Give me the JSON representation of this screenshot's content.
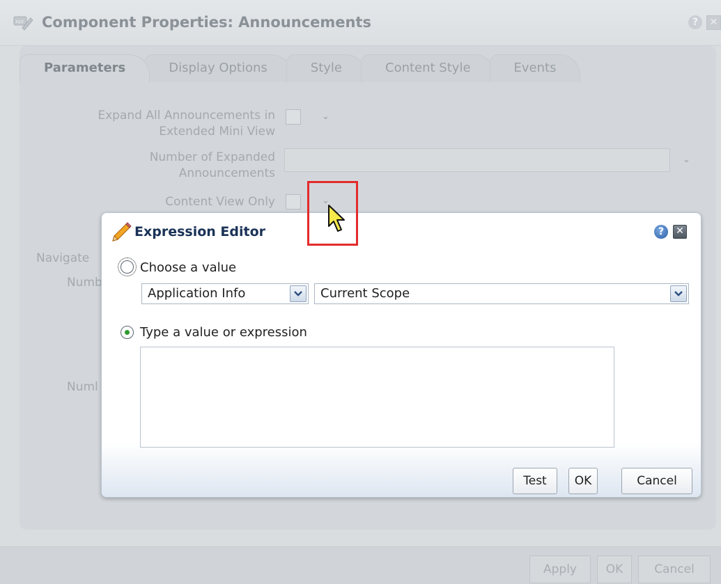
{
  "background_dialog": {
    "title": "Component Properties: Announcements",
    "tabs": [
      "Parameters",
      "Display Options",
      "Style",
      "Content Style",
      "Events"
    ],
    "active_tab": "Parameters",
    "params": {
      "expand_label_line1": "Expand All Announcements in",
      "expand_label_line2": "Extended Mini View",
      "number_label_line1": "Number of Expanded",
      "number_label_line2": "Announcements",
      "content_view_label": "Content View Only",
      "navigate_label_partial": "Navigate",
      "numb_label_partial_1": "Numb",
      "numb_label_partial_2": "Numl"
    },
    "footer": {
      "apply": "Apply",
      "ok": "OK",
      "cancel": "Cancel"
    }
  },
  "expression_editor": {
    "title": "Expression Editor",
    "choose_label": "Choose a value",
    "category_value": "Application Info",
    "scope_value": "Current Scope",
    "type_label": "Type a value or expression",
    "expression_value": "",
    "buttons": {
      "test": "Test",
      "ok": "OK",
      "cancel": "Cancel"
    },
    "selected_option": "type"
  },
  "colors": {
    "highlight": "#e32b2b",
    "title_text": "#1a3257",
    "radio_selected": "#2f9a2f"
  },
  "icons": [
    "properties-icon",
    "help-icon",
    "close-icon",
    "pencil-icon",
    "chevron-down-icon",
    "cursor-icon"
  ]
}
